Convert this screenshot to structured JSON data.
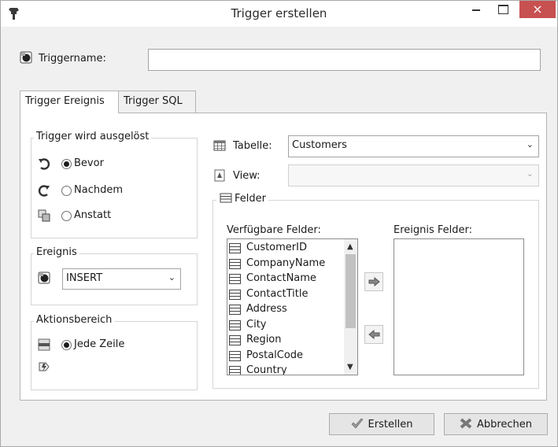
{
  "window": {
    "title": "Trigger erstellen",
    "close_glyph": "×"
  },
  "triggername": {
    "label": "Triggername:",
    "value": "",
    "icon": "trigger-icon"
  },
  "tabs": [
    {
      "label": "Trigger Ereignis",
      "active": true
    },
    {
      "label": "Trigger SQL",
      "active": false
    }
  ],
  "timing_group": {
    "legend": "Trigger wird ausgelöst",
    "options": [
      {
        "label": "Bevor",
        "checked": true,
        "icon": "undo-arrow-icon"
      },
      {
        "label": "Nachdem",
        "checked": false,
        "icon": "redo-arrow-icon"
      },
      {
        "label": "Anstatt",
        "checked": false,
        "icon": "replace-icon"
      }
    ]
  },
  "event_group": {
    "legend": "Ereignis",
    "selected": "INSERT",
    "icon": "trigger-icon"
  },
  "scope_group": {
    "legend": "Aktionsbereich",
    "options": [
      {
        "label": "Jede Zeile",
        "checked": true,
        "icon": "row-icon"
      },
      {
        "label": "",
        "checked": false,
        "icon": "statement-icon"
      }
    ]
  },
  "table_select": {
    "label": "Tabelle:",
    "selected": "Customers",
    "icon": "table-icon"
  },
  "view_select": {
    "label": "View:",
    "selected": "",
    "disabled": true,
    "icon": "view-icon"
  },
  "fields_group": {
    "legend": "Felder",
    "available_label": "Verfügbare Felder:",
    "event_label": "Ereignis Felder:",
    "available_fields": [
      "CustomerID",
      "CompanyName",
      "ContactName",
      "ContactTitle",
      "Address",
      "City",
      "Region",
      "PostalCode",
      "Country"
    ],
    "event_fields": []
  },
  "buttons": {
    "create": "Erstellen",
    "cancel": "Abbrechen"
  },
  "colors": {
    "close_button": "#c75050",
    "window_bg": "#f0f0f0",
    "panel_bg": "#ffffff"
  }
}
